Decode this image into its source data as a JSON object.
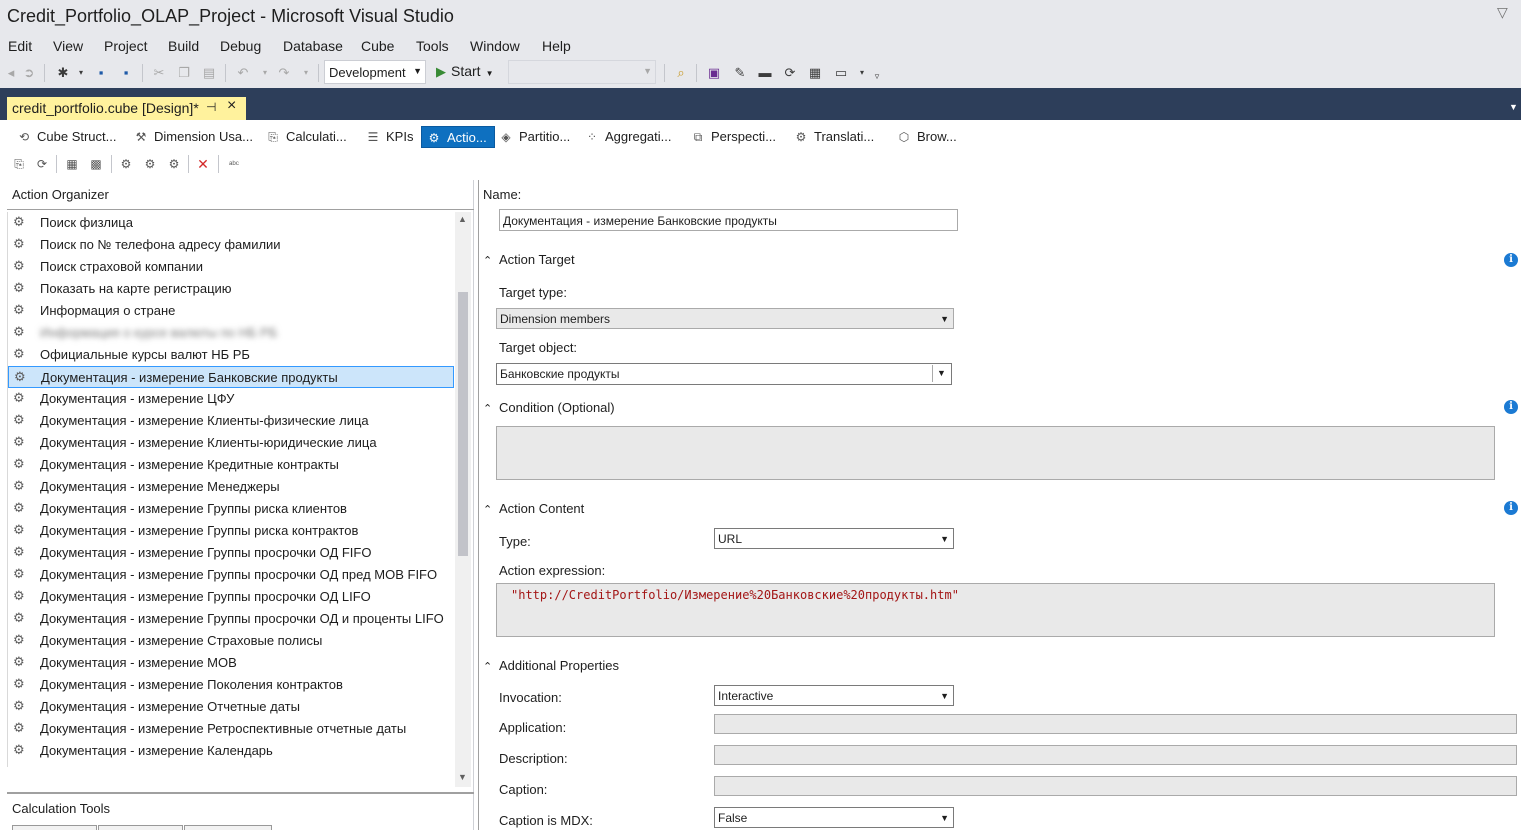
{
  "window": {
    "title": "Credit_Portfolio_OLAP_Project - Microsoft Visual Studio"
  },
  "menu": [
    "Edit",
    "View",
    "Project",
    "Build",
    "Debug",
    "Database",
    "Cube",
    "Tools",
    "Window",
    "Help"
  ],
  "toolbar": {
    "configuration": "Development",
    "start_label": "Start",
    "platform": ""
  },
  "document_tab": {
    "label": "credit_portfolio.cube [Design]*"
  },
  "designer_tabs": [
    {
      "label": "Cube Struct...",
      "icon": "cube-structure-icon"
    },
    {
      "label": "Dimension Usa...",
      "icon": "dimension-usage-icon"
    },
    {
      "label": "Calculati...",
      "icon": "calculations-icon"
    },
    {
      "label": "KPIs",
      "icon": "kpis-icon"
    },
    {
      "label": "Actio...",
      "icon": "actions-icon"
    },
    {
      "label": "Partitio...",
      "icon": "partitions-icon"
    },
    {
      "label": "Aggregati...",
      "icon": "aggregations-icon"
    },
    {
      "label": "Perspecti...",
      "icon": "perspectives-icon"
    },
    {
      "label": "Translati...",
      "icon": "translations-icon"
    },
    {
      "label": "Brow...",
      "icon": "browser-icon"
    }
  ],
  "action_organizer": {
    "header": "Action Organizer",
    "items": [
      "Поиск физлица",
      "Поиск по № телефона адресу фамилии",
      "Поиск страховой компании",
      "Показать на карте регистрацию",
      "Информация о стране",
      "Информация о курсе валюты по НБ РБ",
      "Официальные курсы валют НБ РБ",
      "Документация - измерение Банковские продукты",
      "Документация - измерение ЦФУ",
      "Документация - измерение Клиенты-физические лица",
      "Документация - измерение Клиенты-юридические лица",
      "Документация - измерение Кредитные контракты",
      "Документация - измерение Менеджеры",
      "Документация - измерение Группы риска клиентов",
      "Документация - измерение Группы риска контрактов",
      "Документация - измерение Группы просрочки ОД FIFO",
      "Документация - измерение Группы просрочки ОД пред МОВ FIFO",
      "Документация - измерение Группы просрочки ОД LIFO",
      "Документация - измерение Группы просрочки ОД и проценты LIFO",
      "Документация - измерение Страховые полисы",
      "Документация - измерение МОВ",
      "Документация - измерение Поколения контрактов",
      "Документация - измерение Отчетные даты",
      "Документация - измерение Ретроспективные отчетные даты",
      "Документация - измерение Календарь"
    ],
    "selected_index": 7,
    "blurred_index": 5
  },
  "calculation_tools": {
    "header": "Calculation Tools"
  },
  "properties": {
    "name_label": "Name:",
    "name_value": "Документация - измерение Банковские продукты",
    "action_target": {
      "header": "Action Target",
      "target_type_label": "Target type:",
      "target_type_value": "Dimension members",
      "target_object_label": "Target object:",
      "target_object_value": "Банковские продукты"
    },
    "condition": {
      "header": "Condition (Optional)"
    },
    "action_content": {
      "header": "Action Content",
      "type_label": "Type:",
      "type_value": "URL",
      "expression_label": "Action expression:",
      "expression_value": "\"http://CreditPortfolio/Измерение%20Банковские%20продукты.htm\""
    },
    "additional": {
      "header": "Additional Properties",
      "invocation_label": "Invocation:",
      "invocation_value": "Interactive",
      "application_label": "Application:",
      "description_label": "Description:",
      "caption_label": "Caption:",
      "caption_mdx_label": "Caption is MDX:",
      "caption_mdx_value": "False"
    }
  }
}
